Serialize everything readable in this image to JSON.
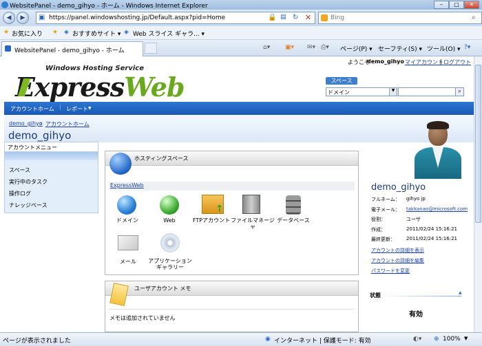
{
  "window": {
    "title": "WebsitePanel - demo_gihyo - ホーム - Windows Internet Explorer"
  },
  "address": {
    "url": "https://panel.windowshosting.jp/Default.aspx?pid=Home",
    "search_engine": "Bing"
  },
  "favorites": {
    "favorites_label": "お気に入り",
    "recommended": "おすすめサイト ▾",
    "webslice": "Web スライス ギャラ... ▾"
  },
  "tab": {
    "label": "WebsitePanel - demo_gihyo - ホーム"
  },
  "commands": {
    "page": "ページ(P) ▾",
    "safety": "セーフティ(S) ▾",
    "tools": "ツール(O) ▾"
  },
  "header": {
    "logo_top": "Windows Hosting Service",
    "logo_main_1": "Express",
    "logo_main_2": "Web",
    "welcome_prefix": "ようこそ",
    "welcome_user": "demo_gihyo",
    "my_account": "マイアカウント",
    "logout": "ログアウト",
    "space_button": "スペース",
    "domain_select": "ドメイン"
  },
  "navbar": {
    "account_home": "アカウントホーム",
    "reports": "レポート"
  },
  "breadcrumb": {
    "user": "demo_gihyo",
    "separator": "›",
    "home": "アカウントホーム"
  },
  "page_title": "demo_gihyo",
  "account_menu": {
    "title": "アカウントメニュー",
    "items": [
      "スペース",
      "実行中のタスク",
      "操作ログ",
      "ナレッジベース"
    ]
  },
  "hosting_space": {
    "title": "ホスティングスペース",
    "space_name": "ExpressWeb",
    "icons": [
      {
        "label": "ドメイン"
      },
      {
        "label": "Web"
      },
      {
        "label": "FTPアカウント"
      },
      {
        "label": "ファイルマネージャ"
      },
      {
        "label": "データベース"
      },
      {
        "label": "メール"
      },
      {
        "label": "アプリケーションギャラリー"
      }
    ]
  },
  "user_memo": {
    "title": "ユーザアカウント メモ",
    "text": "メモは追加されていません"
  },
  "user_info": {
    "name": "demo_gihyo",
    "fullname_label": "フルネーム：",
    "fullname_value": "gihyo jp",
    "email_label": "電子メール：",
    "email_value": "takkanao@microsoft.com",
    "role_label": "役割：",
    "role_value": "ユーザ",
    "created_label": "作成：",
    "created_value": "2011/02/24 15:16:21",
    "updated_label": "最終更新：",
    "updated_value": "2011/02/24 15:16:21",
    "link_details": "アカウントの詳細を表示",
    "link_edit": "アカウントの詳細を編集",
    "link_password": "パスワードを変更",
    "status_label": "状態",
    "status_value": "有効"
  },
  "statusbar": {
    "left": "ページが表示されました",
    "zone": "インターネット | 保護モード: 有効",
    "zoom": "100%"
  }
}
